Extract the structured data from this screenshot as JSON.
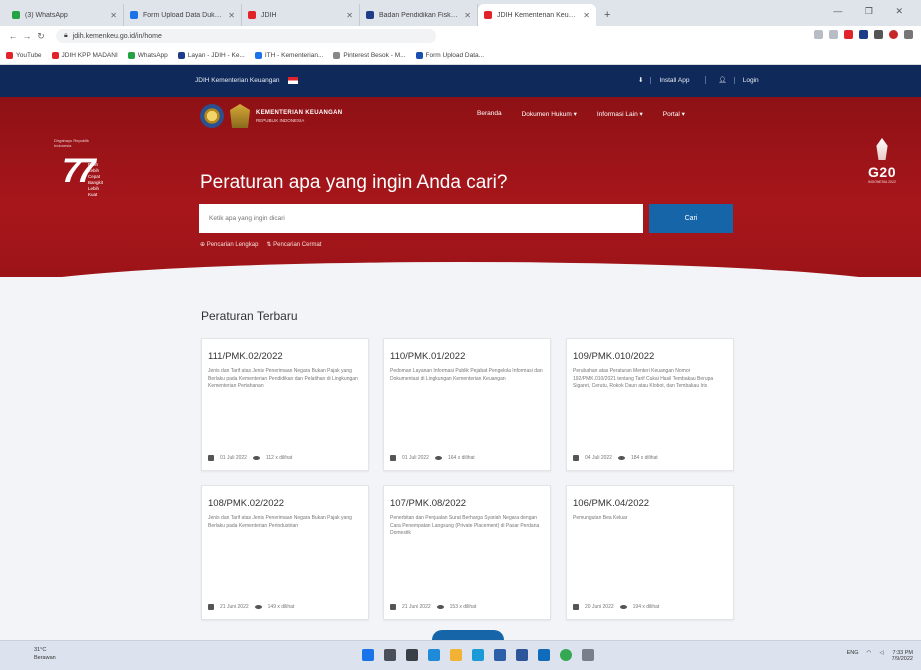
{
  "browser": {
    "tabs": [
      {
        "label": "(3) WhatsApp",
        "active": false,
        "color": "#25a244"
      },
      {
        "label": "Form Upload Data Dukung Pen",
        "active": false,
        "color": "#1a73e8"
      },
      {
        "label": "JDIH",
        "active": false,
        "color": "#e0242a"
      },
      {
        "label": "Badan Pendidikan Fiskal Kem",
        "active": false,
        "color": "#1f3c88"
      },
      {
        "label": "JDIH Kementerian Keuangan",
        "active": true,
        "color": "#e0242a"
      }
    ],
    "new_tab": "+",
    "window_controls": "— ❐ ✕",
    "url": "jdih.kemenkeu.go.id/in/home",
    "bookmarks": [
      "YouTube",
      "JDIH KPP MADANI",
      "WhatsApp",
      "Layan - JDIH - Ke...",
      "ITH - Kementerian...",
      "Pinterest Besok - M...",
      "Form Upload Data..."
    ]
  },
  "site": {
    "topbar_left": "JDIH Kementerian Keuangan",
    "topbar_right": {
      "install": "Install App",
      "login": "Login"
    },
    "logo_line1": "KEMENTERIAN KEUANGAN",
    "logo_line2": "REPUBLIK INDONESIA",
    "nav": [
      "Beranda",
      "Dokumen Hukum ▾",
      "Informasi Lain ▾",
      "Portal ▾"
    ],
    "badge": {
      "number": "77",
      "text": "Pulih Lebih Cepat Bangkit Lebih Kuat",
      "tiny": "Dirgahayu Republik Indonesia"
    },
    "g20": {
      "label": "G20",
      "sub": "INDONESIA 2022"
    },
    "hero_title": "Peraturan apa yang ingin Anda cari?",
    "search": {
      "placeholder": "Ketik apa yang ingin dicari",
      "button": "Cari",
      "link1": "⊕ Pencarian Lengkap",
      "link2": "⇅ Pencarian Cermat"
    },
    "section_title": "Peraturan Terbaru",
    "cards": [
      {
        "title": "111/PMK.02/2022",
        "desc": "Jenis dan Tarif atas Jenis Penerimaan Negara Bukan Pajak yang Berlaku pada Kementerian Pendidikan dan Pelatihan di Lingkungan Kementerian Pertahanan",
        "date": "01 Juli 2022",
        "views": "112 x dilihat"
      },
      {
        "title": "110/PMK.01/2022",
        "desc": "Pedoman Layanan Informasi Publik Pejabat Pengelola Informasi dan Dokumentasi di Lingkungan Kementerian Keuangan",
        "date": "01 Juli 2022",
        "views": "164 x dilihat"
      },
      {
        "title": "109/PMK.010/2022",
        "desc": "Perubahan atas Peraturan Menteri Keuangan Nomor 192/PMK.010/2021 tentang Tarif Cukai Hasil Tembakau Berupa Sigaret, Cerutu, Rokok Daun atau Klobot, dan Tembakau Iris",
        "date": "04 Juli 2022",
        "views": "184 x dilihat"
      },
      {
        "title": "108/PMK.02/2022",
        "desc": "Jenis dan Tarif atas Jenis Penerimaan Negara Bukan Pajak yang Berlaku pada Kementerian Perindustrian",
        "date": "21 Juni 2022",
        "views": "149 x dilihat"
      },
      {
        "title": "107/PMK.08/2022",
        "desc": "Penerbitan dan Penjualan Surat Berharga Syariah Negara dengan Cara Penempatan Langsung (Private Placement) di Pasar Perdana Domestik",
        "date": "21 Juni 2022",
        "views": "153 x dilihat"
      },
      {
        "title": "106/PMK.04/2022",
        "desc": "Pemungutan Bea Keluar",
        "date": "20 Juni 2022",
        "views": "194 x dilihat"
      }
    ]
  },
  "taskbar": {
    "weather_temp": "31°C",
    "weather_text": "Berawan",
    "clock": "7:33 PM",
    "date": "7/9/2022",
    "tray": "ENG"
  }
}
